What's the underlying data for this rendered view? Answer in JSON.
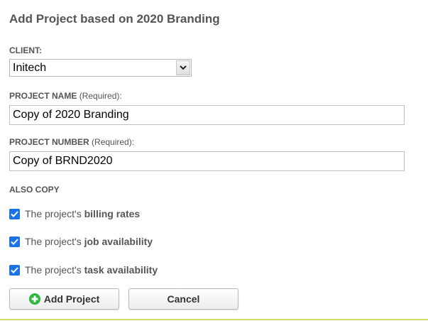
{
  "dialog": {
    "title": "Add Project based on 2020 Branding"
  },
  "client": {
    "label": "CLIENT:",
    "selected": "Initech"
  },
  "project_name": {
    "label": "PROJECT NAME",
    "required": "(Required):",
    "value": "Copy of 2020 Branding"
  },
  "project_number": {
    "label": "PROJECT NUMBER",
    "required": "(Required):",
    "value": "Copy of BRND2020"
  },
  "also_copy": {
    "label": "ALSO COPY",
    "options": [
      {
        "prefix": "The project's",
        "bold": "billing rates",
        "checked": true
      },
      {
        "prefix": "The project's",
        "bold": "job availability",
        "checked": true
      },
      {
        "prefix": "The project's",
        "bold": "task availability",
        "checked": true
      }
    ]
  },
  "actions": {
    "add_label": "Add Project",
    "cancel_label": "Cancel"
  },
  "colors": {
    "checkbox": "#1a73e8",
    "add_icon": "#2db83d",
    "bottom_rule": "#d3d96a"
  },
  "icons": {
    "select_arrow": "chevron-down-icon",
    "add": "plus-circle-icon",
    "check": "checkmark-icon"
  }
}
